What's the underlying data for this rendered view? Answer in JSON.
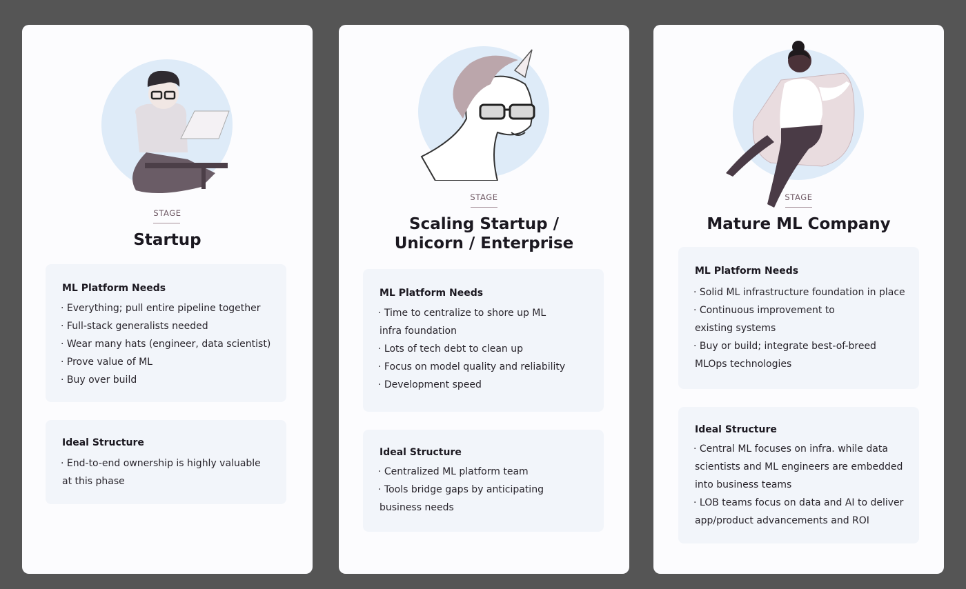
{
  "cards": [
    {
      "illustration": "developer-with-laptop",
      "stage_label": "STAGE",
      "title": "Startup",
      "needs": {
        "heading": "ML Platform Needs",
        "items": [
          "Everything; pull entire pipeline together",
          "Full-stack generalists needed",
          "Wear many hats (engineer, data scientist)",
          "Prove value of ML",
          "Buy over build"
        ]
      },
      "structure": {
        "heading": "Ideal Structure",
        "items": [
          [
            "End-to-end ownership is highly valuable",
            "at this phase"
          ]
        ]
      }
    },
    {
      "illustration": "unicorn-with-glasses",
      "stage_label": "STAGE",
      "title_lines": [
        "Scaling Startup /",
        "Unicorn / Enterprise"
      ],
      "needs": {
        "heading": "ML Platform Needs",
        "items": [
          [
            "Time to centralize to shore up ML",
            "infra foundation"
          ],
          "Lots of tech debt to clean up",
          "Focus on model quality and reliability",
          "Development speed"
        ]
      },
      "structure": {
        "heading": "Ideal Structure",
        "items": [
          "Centralized ML platform team",
          [
            "Tools bridge gaps by anticipating",
            "business needs"
          ]
        ]
      }
    },
    {
      "illustration": "woman-in-armchair",
      "stage_label": "STAGE",
      "title": "Mature ML Company",
      "needs": {
        "heading": "ML Platform Needs",
        "items": [
          "Solid ML infrastructure foundation in place",
          [
            "Continuous improvement to",
            "existing systems"
          ],
          [
            "Buy or build; integrate best-of-breed",
            "MLOps technologies"
          ]
        ]
      },
      "structure": {
        "heading": "Ideal Structure",
        "items": [
          [
            "Central ML focuses on infra. while data",
            "scientists and ML engineers are embedded",
            "into business teams"
          ],
          [
            "LOB teams focus on data and AI to deliver",
            "app/product advancements and ROI"
          ]
        ]
      }
    }
  ]
}
